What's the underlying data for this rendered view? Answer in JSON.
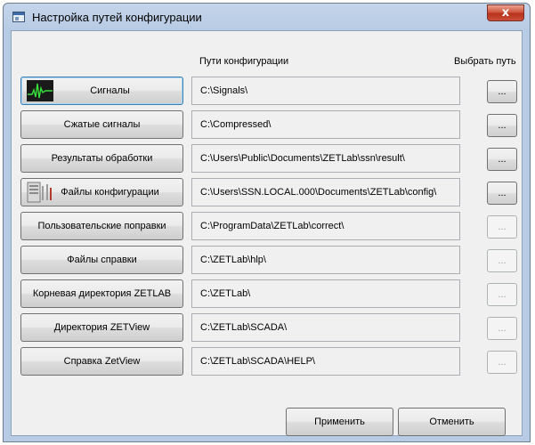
{
  "window": {
    "title": "Настройка путей конфигурации",
    "close_label": "x"
  },
  "headers": {
    "paths": "Пути конфигурации",
    "choose": "Выбрать путь"
  },
  "rows": [
    {
      "label": "Сигналы",
      "path": "C:\\Signals\\",
      "browse": "...",
      "browse_enabled": true,
      "icon": "signal-graph-icon",
      "focused": true
    },
    {
      "label": "Сжатые сигналы",
      "path": "C:\\Compressed\\",
      "browse": "...",
      "browse_enabled": true
    },
    {
      "label": "Результаты обработки",
      "path": "C:\\Users\\Public\\Documents\\ZETLab\\ssn\\result\\",
      "browse": "...",
      "browse_enabled": true
    },
    {
      "label": "Файлы конфигурации",
      "path": "C:\\Users\\SSN.LOCAL.000\\Documents\\ZETLab\\config\\",
      "browse": "...",
      "browse_enabled": true,
      "icon": "config-settings-icon"
    },
    {
      "label": "Пользовательские поправки",
      "path": "C:\\ProgramData\\ZETLab\\correct\\",
      "browse": "...",
      "browse_enabled": false
    },
    {
      "label": "Файлы справки",
      "path": "C:\\ZETLab\\hlp\\",
      "browse": "...",
      "browse_enabled": false
    },
    {
      "label": "Корневая директория ZETLAB",
      "path": "C:\\ZETLab\\",
      "browse": "...",
      "browse_enabled": false
    },
    {
      "label": "Директория ZETView",
      "path": "C:\\ZETLab\\SCADA\\",
      "browse": "...",
      "browse_enabled": false
    },
    {
      "label": "Справка ZetView",
      "path": "C:\\ZETLab\\SCADA\\HELP\\",
      "browse": "...",
      "browse_enabled": false
    }
  ],
  "footer": {
    "apply": "Применить",
    "cancel": "Отменить"
  },
  "colors": {
    "title_bar": "#b7cbe4",
    "client_bg": "#f0f0f0",
    "close_button": "#c9503a"
  }
}
